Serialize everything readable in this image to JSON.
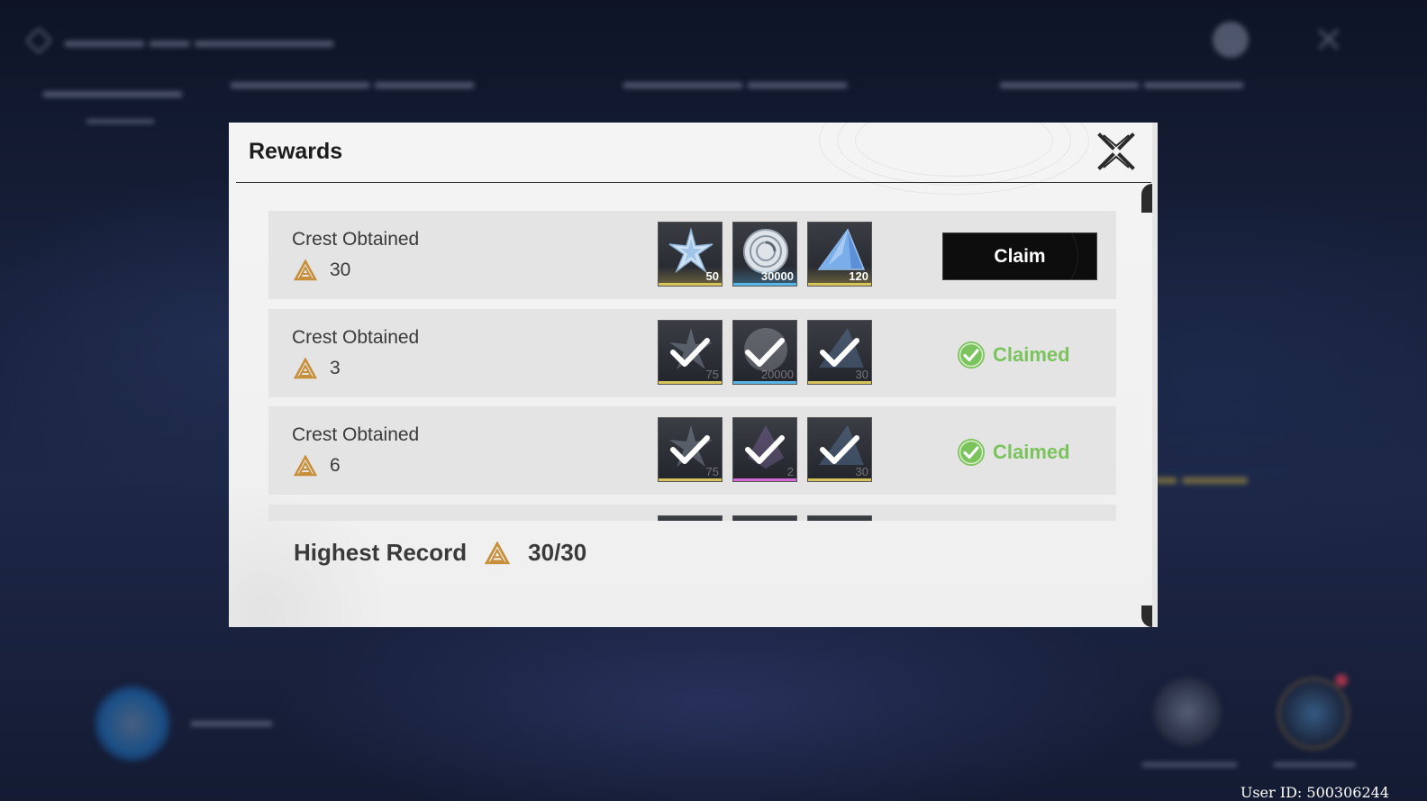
{
  "modal": {
    "title": "Rewards"
  },
  "rows": [
    {
      "title": "Crest Obtained",
      "crests": "30",
      "status": "claimable",
      "button_label": "Claim",
      "items": [
        {
          "icon": "star-crystal-icon",
          "qty": "50",
          "rarity_color": "#d9c35b"
        },
        {
          "icon": "shell-credit-icon",
          "qty": "30000",
          "rarity_color": "#5ab4e6"
        },
        {
          "icon": "blue-crystal-pyramid-icon",
          "qty": "120",
          "rarity_color": "#d9c35b"
        }
      ]
    },
    {
      "title": "Crest Obtained",
      "crests": "3",
      "status": "claimed",
      "status_label": "Claimed",
      "items": [
        {
          "icon": "star-crystal-icon",
          "qty": "75",
          "rarity_color": "#d9c35b"
        },
        {
          "icon": "shell-credit-icon",
          "qty": "20000",
          "rarity_color": "#5ab4e6"
        },
        {
          "icon": "blue-crystal-pyramid-icon",
          "qty": "30",
          "rarity_color": "#d9c35b"
        }
      ]
    },
    {
      "title": "Crest Obtained",
      "crests": "6",
      "status": "claimed",
      "status_label": "Claimed",
      "items": [
        {
          "icon": "star-crystal-icon",
          "qty": "75",
          "rarity_color": "#d9c35b"
        },
        {
          "icon": "purple-crystal-icon",
          "qty": "2",
          "rarity_color": "#d46ad8"
        },
        {
          "icon": "blue-crystal-pyramid-icon",
          "qty": "30",
          "rarity_color": "#d9c35b"
        }
      ]
    }
  ],
  "highest_record": {
    "label": "Highest Record",
    "value": "30/30"
  },
  "user_id": "User ID: 500306244",
  "colors": {
    "claimed_green": "#7ac35d",
    "crest_gold": "#c88f3a"
  }
}
